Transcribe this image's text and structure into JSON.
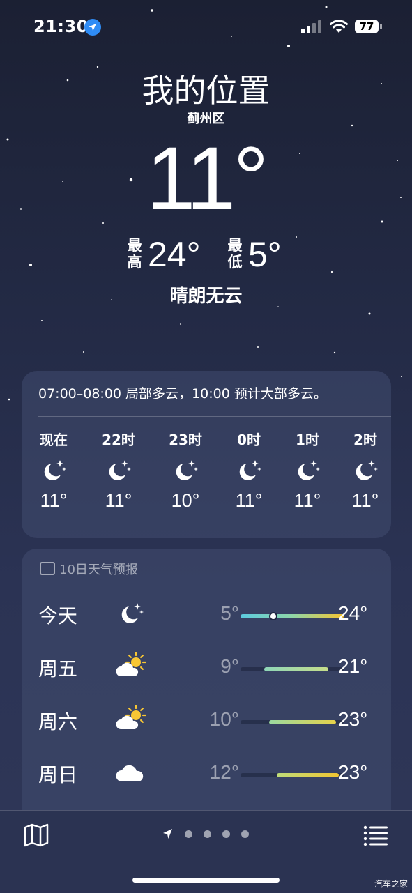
{
  "status_bar": {
    "time": "21:30",
    "location_icon": "location-arrow-icon",
    "battery": "77",
    "signal_icon": "cellular-signal-icon",
    "wifi_icon": "wifi-icon"
  },
  "hero": {
    "city": "我的位置",
    "district": "蓟州区",
    "temperature": "11°",
    "high_label": "最高",
    "high_value": "24°",
    "low_label": "最低",
    "low_value": "5°",
    "condition": "晴朗无云"
  },
  "hourly": {
    "summary": "07:00–08:00 局部多云，10:00 预计大部多云。",
    "hours": [
      {
        "label": "现在",
        "icon": "moon-stars-icon",
        "temp": "11°"
      },
      {
        "label": "22时",
        "icon": "moon-stars-icon",
        "temp": "11°"
      },
      {
        "label": "23时",
        "icon": "moon-stars-icon",
        "temp": "10°"
      },
      {
        "label": "0时",
        "icon": "moon-stars-icon",
        "temp": "11°"
      },
      {
        "label": "1时",
        "icon": "moon-stars-icon",
        "temp": "11°"
      },
      {
        "label": "2时",
        "icon": "moon-stars-icon",
        "temp": "11°"
      }
    ]
  },
  "daily": {
    "title": "10日天气预报",
    "days": [
      {
        "day": "今天",
        "icon": "moon-stars-icon",
        "low": "5°",
        "high": "24°",
        "range_start": 0.0,
        "range_end": 1.0,
        "current": 0.32,
        "bar_colors": [
          "#5ccbe0",
          "#8ed6a8",
          "#f5c431"
        ]
      },
      {
        "day": "周五",
        "icon": "sun-behind-cloud-icon",
        "low": "9°",
        "high": "21°",
        "range_start": 0.23,
        "range_end": 0.85,
        "bar_colors": [
          "#8ed6b8",
          "#c6dd8a"
        ]
      },
      {
        "day": "周六",
        "icon": "sun-behind-cloud-icon",
        "low": "10°",
        "high": "23°",
        "range_start": 0.28,
        "range_end": 0.93,
        "bar_colors": [
          "#9bd9a0",
          "#e6d24a"
        ]
      },
      {
        "day": "周日",
        "icon": "cloud-icon",
        "low": "12°",
        "high": "23°",
        "range_start": 0.35,
        "range_end": 0.95,
        "bar_colors": [
          "#bfdc7a",
          "#f2c631"
        ]
      }
    ]
  },
  "toolbar": {
    "map_icon": "map-icon",
    "pager_icons": [
      "location-arrow-icon",
      "page-dot",
      "page-dot",
      "page-dot",
      "page-dot"
    ],
    "list_icon": "list-icon"
  },
  "watermark": "汽车之家"
}
